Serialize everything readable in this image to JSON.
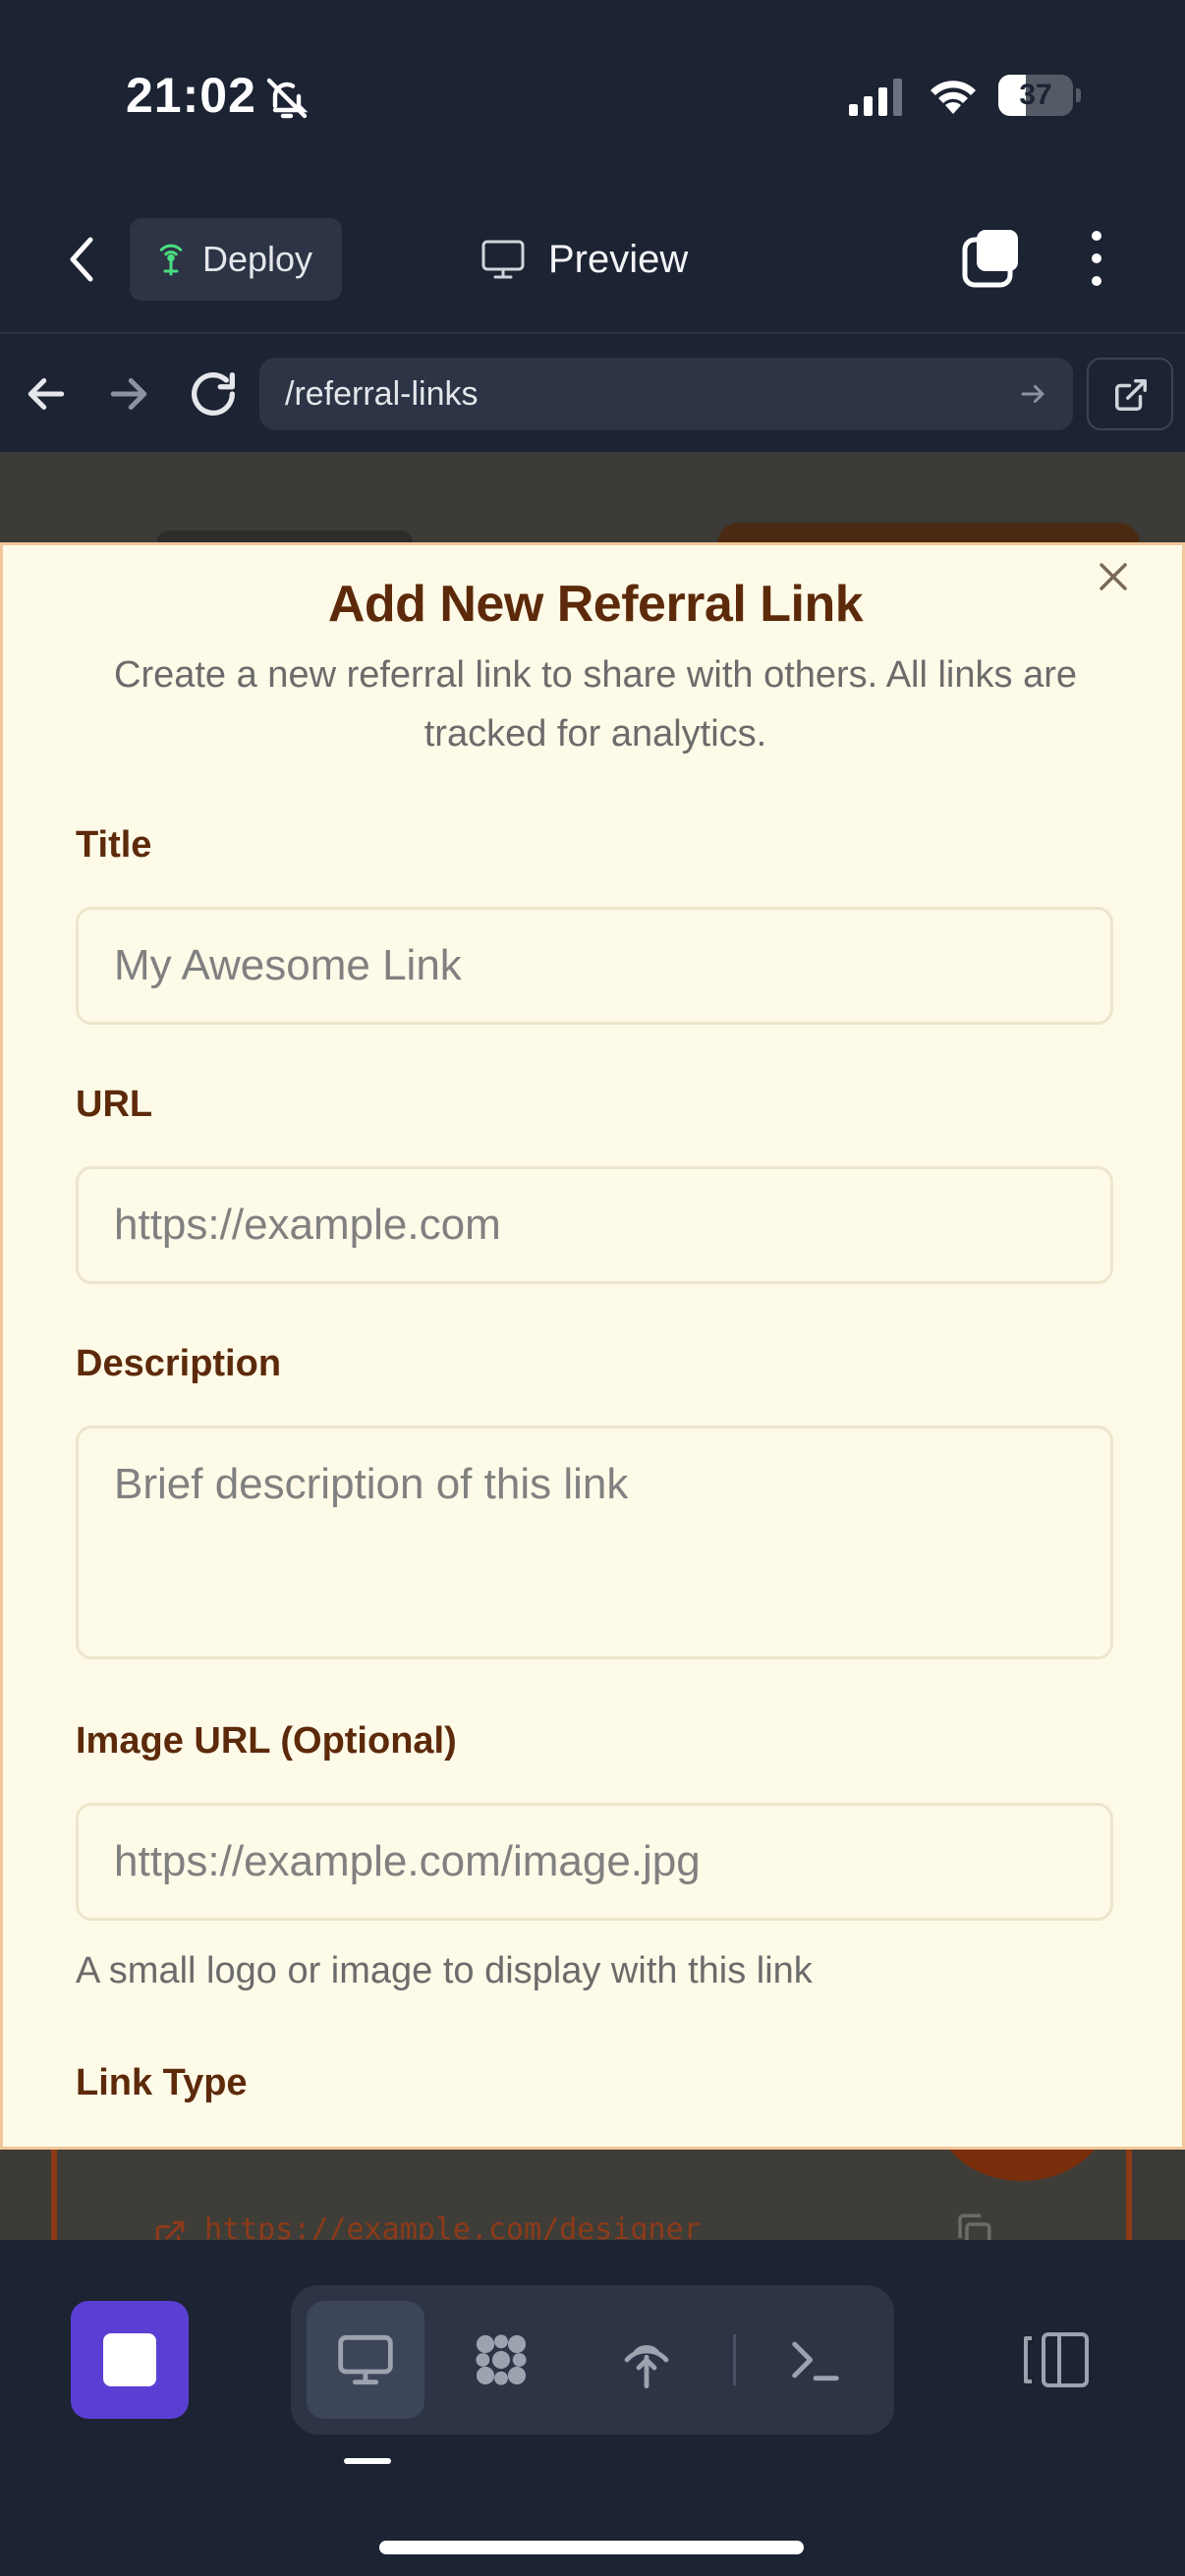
{
  "status_bar": {
    "time": "21:02",
    "battery_level": "37",
    "battery_fraction": 0.37
  },
  "app_header": {
    "deploy_label": "Deploy",
    "preview_label": "Preview"
  },
  "browser": {
    "url": "/referral-links"
  },
  "background_page": {
    "link_text": "https://example.com/designer"
  },
  "modal": {
    "title": "Add New Referral Link",
    "description": "Create a new referral link to share with others. All links are tracked for analytics.",
    "fields": {
      "title": {
        "label": "Title",
        "placeholder": "My Awesome Link",
        "value": ""
      },
      "url": {
        "label": "URL",
        "placeholder": "https://example.com",
        "value": ""
      },
      "description": {
        "label": "Description",
        "placeholder": "Brief description of this link",
        "value": ""
      },
      "image_url": {
        "label": "Image URL (Optional)",
        "placeholder": "https://example.com/image.jpg",
        "help": "A small logo or image to display with this link",
        "value": ""
      },
      "link_type": {
        "label": "Link Type"
      }
    }
  },
  "colors": {
    "modal_background": "#fefae8",
    "label_brown": "#5c2a0a",
    "app_dark": "#1c2333",
    "stop_purple": "#5b3fd4"
  },
  "icons": {
    "deploy": "antenna-icon",
    "preview": "monitor-icon",
    "tools": [
      "monitor-icon",
      "grid-dots-icon",
      "broadcast-icon",
      "terminal-icon"
    ],
    "panels": "panels-icon"
  }
}
